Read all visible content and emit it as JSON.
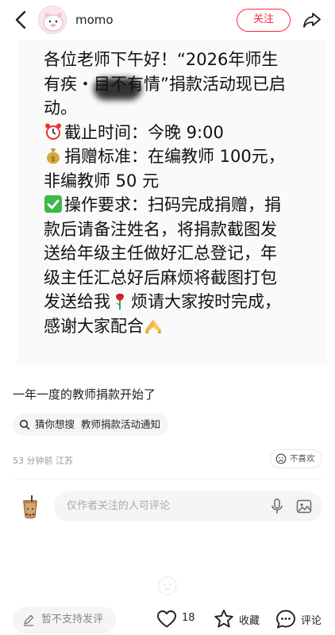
{
  "header": {
    "username": "momo",
    "follow_label": "关注"
  },
  "post_image": {
    "cut_line": "各位老师下午好！“2026年师生",
    "message": [
      "各位老师下午好！“2026年师生",
      "有疾・目不有情”捐款活动现已启",
      "动。",
      "截止时间：今晚 9:00",
      "捐赠标准：在编教师 100元，",
      "非编教师 50 元",
      "操作要求：扫码完成捐赠，捐",
      "款后请备注姓名，将捐款截图发",
      "送给年级主任做好汇总登记，年",
      "级主任汇总好后麻烦将截图打包",
      "发送给我",
      "烦请大家按时完成，",
      "感谢大家配合"
    ]
  },
  "post": {
    "title": "一年一度的教师捐款开始了",
    "suggest_label": "猜你想搜",
    "suggest_query": "教师捐款活动通知",
    "time": "53 分钟前",
    "location": "江苏",
    "dislike_label": "不喜欢"
  },
  "comment": {
    "placeholder": "仅作者关注的人可评论"
  },
  "bottom_bar": {
    "input_label": "暂不支持发评",
    "likes": "18",
    "collect_label": "收藏",
    "comment_label": "评论"
  },
  "colors": {
    "accent": "#ff2442",
    "muted": "#999999",
    "input_bg": "#f5f5f5"
  }
}
